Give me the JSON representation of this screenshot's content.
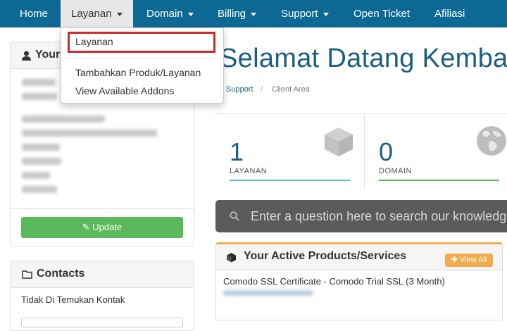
{
  "nav": {
    "items": [
      "Home",
      "Layanan",
      "Domain",
      "Billing",
      "Support",
      "Open Ticket",
      "Afiliasi"
    ]
  },
  "dropdown": {
    "items": [
      "Layanan",
      "Tambahkan Produk/Layanan",
      "View Available Addons"
    ],
    "highlighted": "Layanan"
  },
  "info_panel": {
    "title": "Your",
    "update_label": "Update"
  },
  "contacts_panel": {
    "title": "Contacts",
    "empty_text": "Tidak Di Temukan Kontak"
  },
  "main": {
    "title": "Selamat Datang Kembali",
    "breadcrumb": [
      "Support",
      "Client Area"
    ],
    "stats": [
      {
        "value": "1",
        "label": "LAYANAN",
        "color": "#5bc0de",
        "icon": "cube-icon"
      },
      {
        "value": "0",
        "label": "DOMAIN",
        "color": "#5cb85c",
        "icon": "globe-icon"
      }
    ],
    "search_placeholder": "Enter a question here to search our knowledge",
    "products_panel": {
      "title": "Your Active Products/Services",
      "view_all_label": "View All",
      "items": [
        "Comodo SSL Certificate - Comodo Trial SSL (3 Month)"
      ]
    }
  },
  "colors": {
    "navbar": "#0d6893",
    "title": "#1a5e84",
    "highlight_border": "#c82c2c",
    "update_button": "#5cb85c",
    "view_all_button": "#f0ad4e"
  }
}
